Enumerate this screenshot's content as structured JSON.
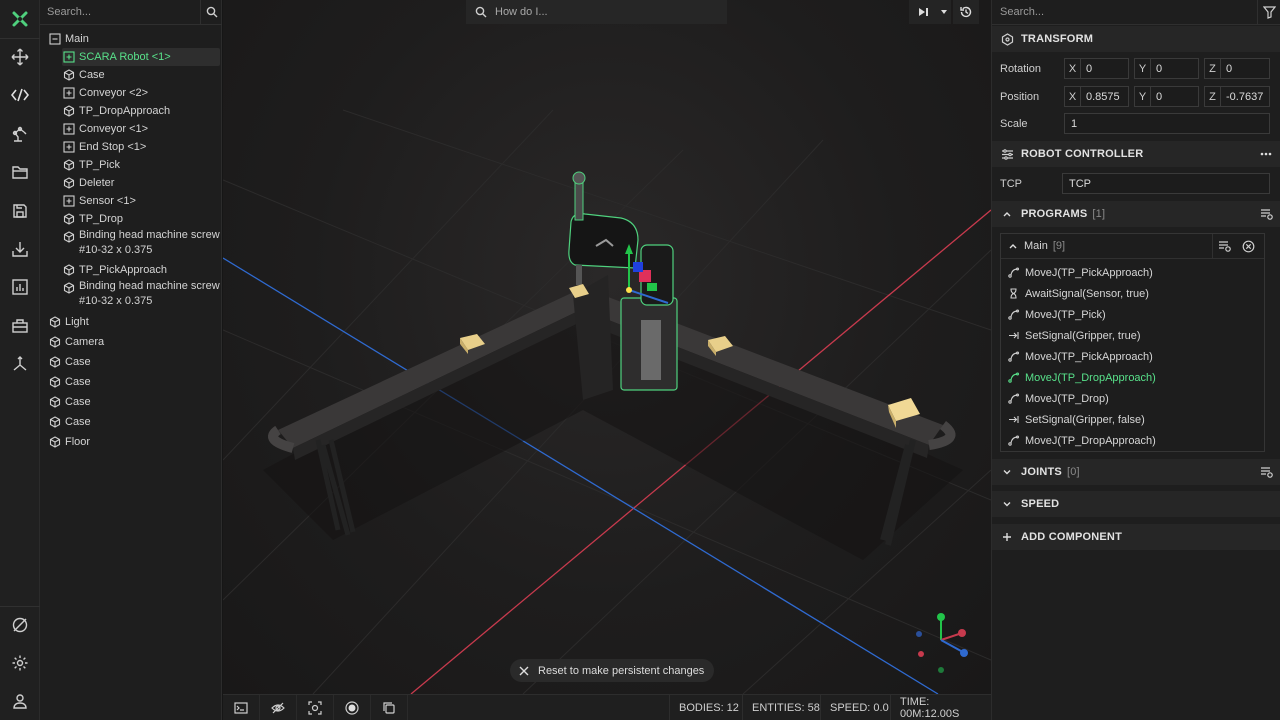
{
  "colors": {
    "accent": "#4fd17e",
    "background": "#161616",
    "panel": "#1e1e1e",
    "selected_text": "#58e18a"
  },
  "rail": {
    "items": [
      "logo-icon",
      "move-icon",
      "code-icon",
      "robot-arm-icon",
      "folder-icon",
      "save-icon",
      "import-icon",
      "chart-icon",
      "toolbox-icon",
      "axes-icon"
    ],
    "bottom_items": [
      "no-sync-icon",
      "gear-icon",
      "user-icon"
    ]
  },
  "tree": {
    "search_placeholder": "Search...",
    "root": "Main",
    "children": [
      {
        "label": "SCARA Robot <1>",
        "icon": "expand-box-icon",
        "selected": true
      },
      {
        "label": "Case",
        "icon": "cube-icon"
      },
      {
        "label": "Conveyor <2>",
        "icon": "expand-box-icon"
      },
      {
        "label": "TP_DropApproach",
        "icon": "cube-icon"
      },
      {
        "label": "Conveyor <1>",
        "icon": "expand-box-icon"
      },
      {
        "label": "End Stop <1>",
        "icon": "expand-box-icon"
      },
      {
        "label": "TP_Pick",
        "icon": "cube-icon"
      },
      {
        "label": "Deleter",
        "icon": "cube-icon"
      },
      {
        "label": "Sensor <1>",
        "icon": "expand-box-icon"
      },
      {
        "label": "TP_Drop",
        "icon": "cube-icon"
      },
      {
        "label": "Binding head machine screw #10-32 x 0.375",
        "icon": "cube-icon",
        "lines": [
          "Binding head machine screw",
          "#10-32 x 0.375"
        ]
      },
      {
        "label": "TP_PickApproach",
        "icon": "cube-icon"
      },
      {
        "label": "Binding head machine screw #10-32 x 0.375",
        "icon": "cube-icon",
        "lines": [
          "Binding head machine screw",
          "#10-32 x 0.375"
        ]
      }
    ],
    "top_level": [
      "Light",
      "Camera",
      "Case",
      "Case",
      "Case",
      "Case",
      "Floor"
    ]
  },
  "viewport": {
    "search_placeholder": "How do I...",
    "toast": "Reset to make persistent changes"
  },
  "statusbar": {
    "bodies": "BODIES: 12",
    "entities": "ENTITIES: 58",
    "speed": "SPEED: 0.0",
    "time": "TIME: 00M:12.00S"
  },
  "inspector": {
    "search_placeholder": "Search...",
    "transform": {
      "title": "TRANSFORM",
      "rotation_label": "Rotation",
      "position_label": "Position",
      "scale_label": "Scale",
      "rotation": {
        "x": "0",
        "y": "0",
        "z": "0"
      },
      "position": {
        "x": "0.8575",
        "y": "0",
        "z": "-0.7637"
      },
      "scale": "1",
      "axes": {
        "x": "X",
        "y": "Y",
        "z": "Z"
      }
    },
    "robot_controller": {
      "title": "ROBOT CONTROLLER",
      "tcp_label": "TCP",
      "tcp_value": "TCP"
    },
    "programs": {
      "title": "PROGRAMS",
      "count": "[1]",
      "main_name": "Main",
      "main_count": "[9]",
      "commands": [
        {
          "text": "MoveJ(TP_PickApproach)",
          "icon": "move-curve-icon"
        },
        {
          "text": "AwaitSignal(Sensor, true)",
          "icon": "hourglass-icon"
        },
        {
          "text": "MoveJ(TP_Pick)",
          "icon": "move-curve-icon"
        },
        {
          "text": "SetSignal(Gripper, true)",
          "icon": "signal-arrow-icon"
        },
        {
          "text": "MoveJ(TP_PickApproach)",
          "icon": "move-curve-icon"
        },
        {
          "text": "MoveJ(TP_DropApproach)",
          "icon": "move-curve-icon",
          "active": true
        },
        {
          "text": "MoveJ(TP_Drop)",
          "icon": "move-curve-icon"
        },
        {
          "text": "SetSignal(Gripper, false)",
          "icon": "signal-arrow-icon"
        },
        {
          "text": "MoveJ(TP_DropApproach)",
          "icon": "move-curve-icon"
        }
      ]
    },
    "joints": {
      "title": "JOINTS",
      "count": "[0]"
    },
    "speed": {
      "title": "SPEED"
    },
    "add_component": {
      "title": "ADD COMPONENT"
    }
  }
}
